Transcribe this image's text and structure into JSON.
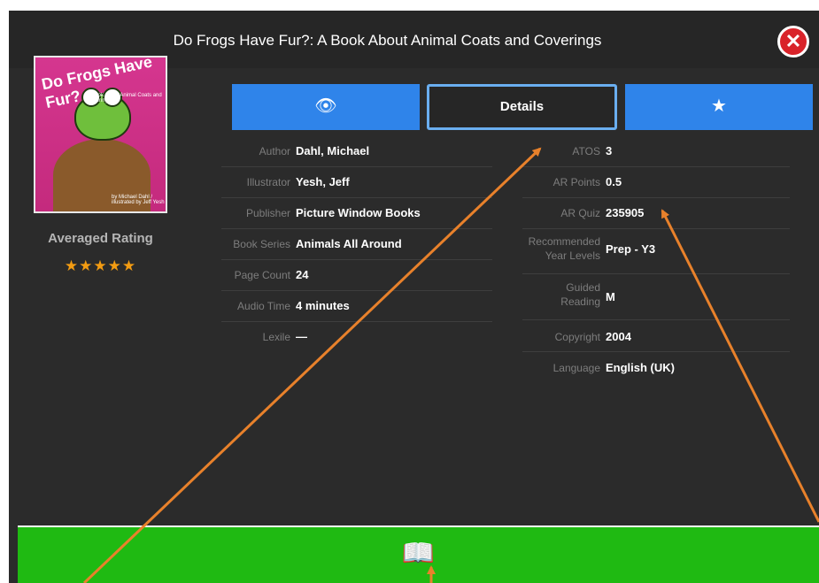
{
  "title": "Do Frogs Have Fur?: A Book About Animal Coats and Coverings",
  "close_icon": "close-icon",
  "cover": {
    "title": "Do Frogs Have Fur?",
    "subtitle": "A Book About Animal Coats and Coverings",
    "credit": "by Michael Dahl / illustrated by Jeff Yesh"
  },
  "rating": {
    "label": "Averaged Rating",
    "stars": "★★★★★",
    "value": 5,
    "max": 5
  },
  "tabs": [
    {
      "icon": "eye-icon",
      "label": ""
    },
    {
      "label": "Details"
    },
    {
      "icon": "star-icon",
      "label": ""
    }
  ],
  "details_left": [
    {
      "label": "Author",
      "value": "Dahl, Michael"
    },
    {
      "label": "Illustrator",
      "value": "Yesh, Jeff"
    },
    {
      "label": "Publisher",
      "value": "Picture Window Books"
    },
    {
      "label": "Book Series",
      "value": "Animals All Around"
    },
    {
      "label": "Page Count",
      "value": "24"
    },
    {
      "label": "Audio Time",
      "value": "4 minutes"
    },
    {
      "label": "Lexile",
      "value": "—"
    }
  ],
  "details_right": [
    {
      "label": "ATOS",
      "value": "3"
    },
    {
      "label": "AR Points",
      "value": "0.5"
    },
    {
      "label": "AR Quiz",
      "value": "235905"
    },
    {
      "label1": "Recommended",
      "label2": "Year Levels",
      "value": "Prep - Y3"
    },
    {
      "label1": "Guided",
      "label2": "Reading",
      "value": "M"
    },
    {
      "label": "Copyright",
      "value": "2004"
    },
    {
      "label": "Language",
      "value": "English (UK)"
    }
  ],
  "read_button": {
    "icon": "open-book-icon"
  },
  "colors": {
    "tab_blue": "#2f84ea",
    "read_green": "#1fba12",
    "close_red": "#d9232a",
    "annotation_orange": "#e8812b",
    "panel": "#2b2b2b"
  }
}
